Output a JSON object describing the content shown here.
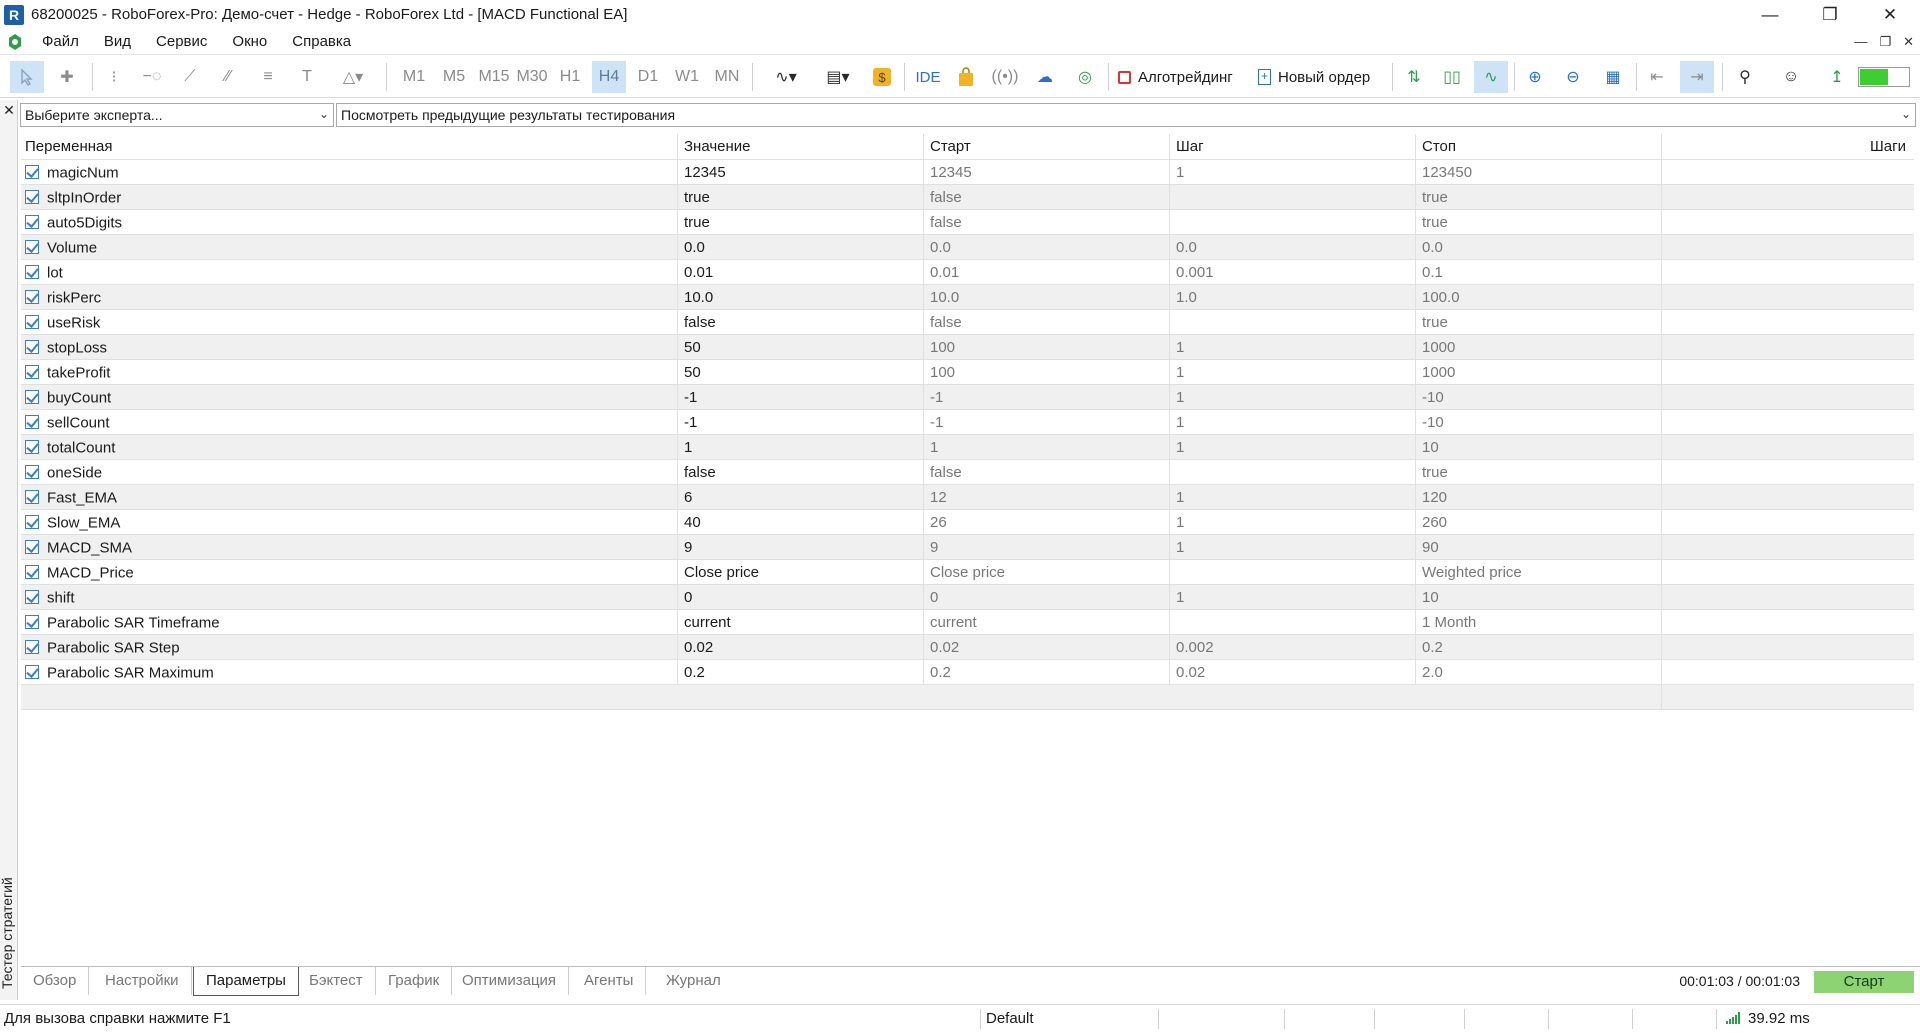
{
  "window": {
    "title": "68200025 - RoboForex-Pro: Демо-счет - Hedge - RoboForex Ltd - [MACD Functional EA]",
    "icon_letter": "R"
  },
  "menu": [
    "Файл",
    "Вид",
    "Сервис",
    "Окно",
    "Справка"
  ],
  "toolbar": {
    "timeframes": [
      "M1",
      "M5",
      "M15",
      "M30",
      "H1",
      "H4",
      "D1",
      "W1",
      "MN"
    ],
    "active_timeframe": "H4",
    "ide_label": "IDE",
    "algo_label": "Алготрейдинг",
    "new_order_label": "Новый ордер"
  },
  "tester": {
    "side_label": "Тестер стратегий",
    "expert_placeholder": "Выберите эксперта...",
    "results_placeholder": "Посмотреть предыдущие результаты тестирования",
    "columns": {
      "variable": "Переменная",
      "value": "Значение",
      "start": "Старт",
      "step": "Шаг",
      "stop": "Стоп",
      "steps": "Шаги"
    },
    "params": [
      {
        "name": "magicNum",
        "value": "12345",
        "start": "12345",
        "step": "1",
        "stop": "123450"
      },
      {
        "name": "sltpInOrder",
        "value": "true",
        "start": "false",
        "step": "",
        "stop": "true"
      },
      {
        "name": "auto5Digits",
        "value": "true",
        "start": "false",
        "step": "",
        "stop": "true"
      },
      {
        "name": "Volume",
        "value": "0.0",
        "start": "0.0",
        "step": "0.0",
        "stop": "0.0"
      },
      {
        "name": "lot",
        "value": "0.01",
        "start": "0.01",
        "step": "0.001",
        "stop": "0.1"
      },
      {
        "name": "riskPerc",
        "value": "10.0",
        "start": "10.0",
        "step": "1.0",
        "stop": "100.0"
      },
      {
        "name": "useRisk",
        "value": "false",
        "start": "false",
        "step": "",
        "stop": "true"
      },
      {
        "name": "stopLoss",
        "value": "50",
        "start": "100",
        "step": "1",
        "stop": "1000"
      },
      {
        "name": "takeProfit",
        "value": "50",
        "start": "100",
        "step": "1",
        "stop": "1000"
      },
      {
        "name": "buyCount",
        "value": "-1",
        "start": "-1",
        "step": "1",
        "stop": "-10"
      },
      {
        "name": "sellCount",
        "value": "-1",
        "start": "-1",
        "step": "1",
        "stop": "-10"
      },
      {
        "name": "totalCount",
        "value": "1",
        "start": "1",
        "step": "1",
        "stop": "10"
      },
      {
        "name": "oneSide",
        "value": "false",
        "start": "false",
        "step": "",
        "stop": "true"
      },
      {
        "name": "Fast_EMA",
        "value": "6",
        "start": "12",
        "step": "1",
        "stop": "120"
      },
      {
        "name": "Slow_EMA",
        "value": "40",
        "start": "26",
        "step": "1",
        "stop": "260"
      },
      {
        "name": "MACD_SMA",
        "value": "9",
        "start": "9",
        "step": "1",
        "stop": "90"
      },
      {
        "name": "MACD_Price",
        "value": "Close price",
        "start": "Close price",
        "step": "",
        "stop": "Weighted price"
      },
      {
        "name": "shift",
        "value": "0",
        "start": "0",
        "step": "1",
        "stop": "10"
      },
      {
        "name": "Parabolic SAR Timeframe",
        "value": "current",
        "start": "current",
        "step": "",
        "stop": "1 Month"
      },
      {
        "name": "Parabolic SAR Step",
        "value": "0.02",
        "start": "0.02",
        "step": "0.002",
        "stop": "0.2"
      },
      {
        "name": "Parabolic SAR Maximum",
        "value": "0.2",
        "start": "0.2",
        "step": "0.02",
        "stop": "2.0"
      }
    ],
    "tabs": [
      "Обзор",
      "Настройки",
      "Параметры",
      "Бэктест",
      "График",
      "Оптимизация",
      "Агенты",
      "Журнал"
    ],
    "active_tab": "Параметры",
    "timer": "00:01:03 / 00:01:03",
    "start_label": "Старт"
  },
  "status": {
    "help": "Для вызова справки нажмите F1",
    "profile": "Default",
    "ping": "39.92 ms"
  },
  "colors": {
    "accent": "#3a7bd5",
    "start_button": "#8dd374",
    "active_toolbar": "#cfe3f6",
    "row_alt": "#f0f0f0"
  }
}
